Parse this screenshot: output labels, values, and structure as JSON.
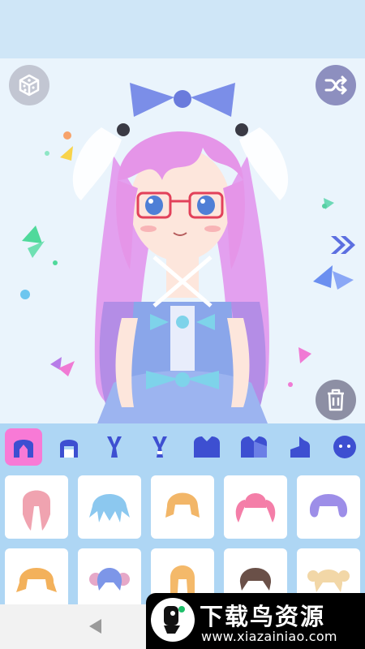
{
  "toolbar": {
    "random_icon": "dice-icon",
    "shuffle_icon": "shuffle-icon",
    "next_icon": "double-chevron-right-icon",
    "delete_icon": "trash-icon"
  },
  "character": {
    "hair_color": "#e595e8",
    "dress_color": "#8aa6ea",
    "bow_color": "#7ed3ea"
  },
  "categories": [
    {
      "id": "hair-front",
      "icon": "front-hair-icon",
      "selected": true
    },
    {
      "id": "hair-front-alt",
      "icon": "bangs-icon",
      "selected": false
    },
    {
      "id": "hair-back",
      "icon": "rabbit-ears-icon",
      "selected": false
    },
    {
      "id": "hair-back-alt",
      "icon": "ears-icon",
      "selected": false
    },
    {
      "id": "clothes-top",
      "icon": "shirt-icon",
      "selected": false
    },
    {
      "id": "clothes-mix",
      "icon": "outfit-icon",
      "selected": false
    },
    {
      "id": "clothes-side",
      "icon": "half-outfit-icon",
      "selected": false
    },
    {
      "id": "face",
      "icon": "face-icon",
      "selected": false
    }
  ],
  "hair_items": [
    {
      "name": "pink-braids",
      "color": "#f0a3b0"
    },
    {
      "name": "blue-spiky",
      "color": "#8cc8ef"
    },
    {
      "name": "orange-bob",
      "color": "#f2b668"
    },
    {
      "name": "pink-twintails",
      "color": "#f47ea8"
    },
    {
      "name": "purple-bob",
      "color": "#9d8ee8"
    },
    {
      "name": "orange-curly",
      "color": "#f3b15b"
    },
    {
      "name": "blue-buns",
      "color": "#7d96e8"
    },
    {
      "name": "orange-long",
      "color": "#f4b96a"
    },
    {
      "name": "brown-short",
      "color": "#6a5048"
    },
    {
      "name": "blonde-buns",
      "color": "#f2d7a7"
    }
  ],
  "colors": {
    "active_tab": "#f87ad6",
    "tab_icon": "#3d4fd1",
    "panel_bg": "#aed6f4",
    "top_bar": "#cfe6f7"
  },
  "watermark": {
    "title": "下载鸟资源",
    "url": "www.xiazainiao.com"
  }
}
